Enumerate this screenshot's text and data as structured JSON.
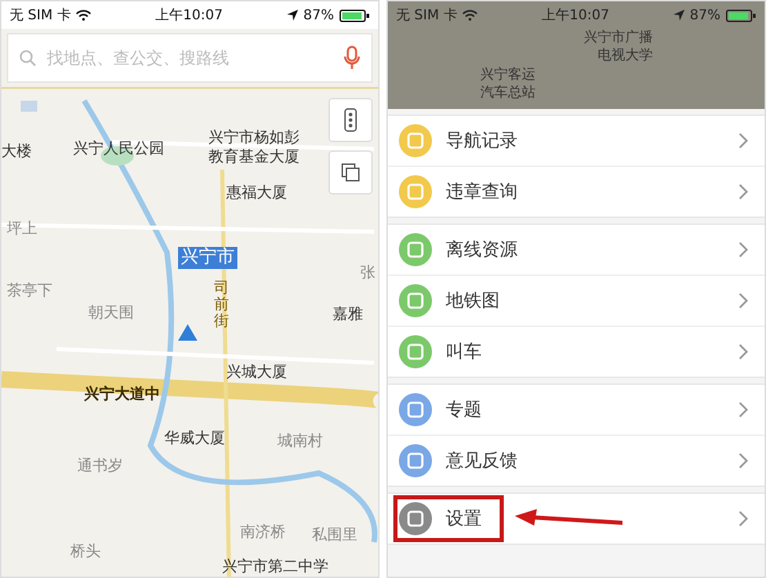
{
  "left_screen": {
    "status_bar": {
      "carrier": "无 SIM 卡",
      "time": "上午10:07",
      "battery": "87%"
    },
    "search": {
      "placeholder": "找地点、查公交、搜路线"
    },
    "map_labels": [
      {
        "text": "大楼",
        "kind": "place"
      },
      {
        "text": "兴宁人民公园",
        "kind": "place"
      },
      {
        "text": "兴宁市杨如彭",
        "kind": "place"
      },
      {
        "text": "教育基金大厦",
        "kind": "place"
      },
      {
        "text": "惠福大厦",
        "kind": "place"
      },
      {
        "text": "坪上",
        "kind": "area"
      },
      {
        "text": "兴宁市",
        "kind": "city"
      },
      {
        "text": "张",
        "kind": "area"
      },
      {
        "text": "茶亭下",
        "kind": "area"
      },
      {
        "text": "朝天围",
        "kind": "area"
      },
      {
        "text": "司前街",
        "kind": "street"
      },
      {
        "text": "嘉雅",
        "kind": "place"
      },
      {
        "text": "兴宁大道中",
        "kind": "road"
      },
      {
        "text": "兴城大厦",
        "kind": "place"
      },
      {
        "text": "华威大厦",
        "kind": "place"
      },
      {
        "text": "城南村",
        "kind": "area"
      },
      {
        "text": "通书岁",
        "kind": "area"
      },
      {
        "text": "南济桥",
        "kind": "area"
      },
      {
        "text": "私围里",
        "kind": "area"
      },
      {
        "text": "桥头",
        "kind": "area"
      },
      {
        "text": "兴宁市第二中学",
        "kind": "place"
      }
    ]
  },
  "right_screen": {
    "status_bar": {
      "carrier": "无 SIM 卡",
      "time": "上午10:07",
      "battery": "87%"
    },
    "map_labels": [
      {
        "text": "兴宁市广播",
        "kind": "place"
      },
      {
        "text": "电视大学",
        "kind": "place"
      },
      {
        "text": "兴宁客运",
        "kind": "place"
      },
      {
        "text": "汽车总站",
        "kind": "place"
      }
    ],
    "menu_groups": [
      {
        "items": [
          {
            "label": "导航记录",
            "color": "#f2c94c",
            "annotated": false
          },
          {
            "label": "违章查询",
            "color": "#f2c94c",
            "annotated": false
          }
        ]
      },
      {
        "items": [
          {
            "label": "离线资源",
            "color": "#7cc96b",
            "annotated": false
          },
          {
            "label": "地铁图",
            "color": "#7cc96b",
            "annotated": false
          },
          {
            "label": "叫车",
            "color": "#7cc96b",
            "annotated": false
          }
        ]
      },
      {
        "items": [
          {
            "label": "专题",
            "color": "#7aa7e6",
            "annotated": false
          },
          {
            "label": "意见反馈",
            "color": "#7aa7e6",
            "annotated": false
          }
        ]
      },
      {
        "items": [
          {
            "label": "设置",
            "color": "#8a8a8a",
            "annotated": true
          }
        ]
      }
    ]
  }
}
